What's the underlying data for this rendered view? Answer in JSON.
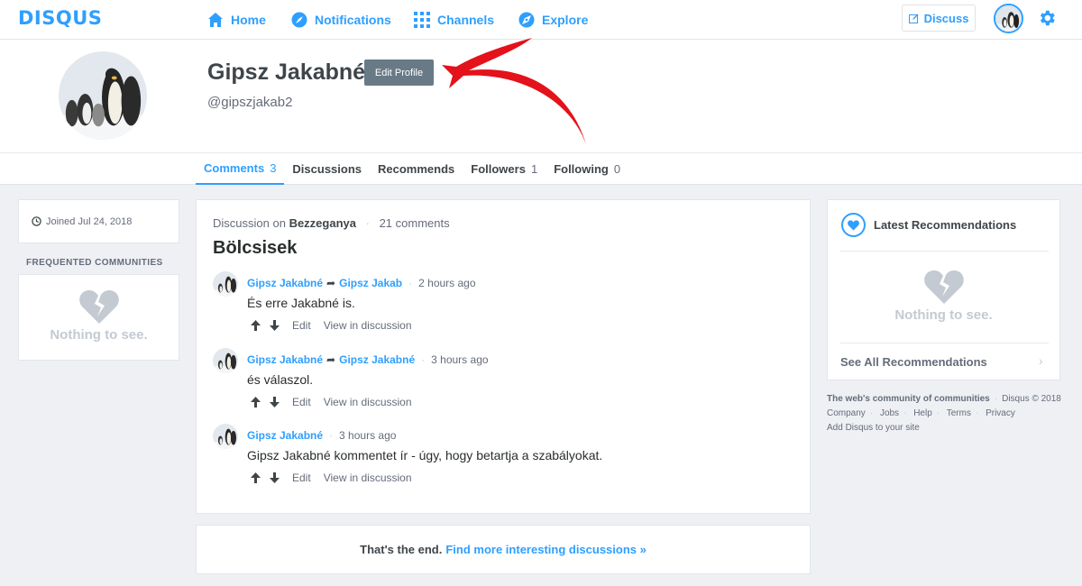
{
  "header": {
    "logo": "DISQUS",
    "nav": [
      {
        "label": "Home",
        "icon": "home-icon"
      },
      {
        "label": "Notifications",
        "icon": "compass-icon"
      },
      {
        "label": "Channels",
        "icon": "grid-icon"
      },
      {
        "label": "Explore",
        "icon": "explore-icon"
      }
    ],
    "discuss_label": "Discuss",
    "accent": "#2e9fff"
  },
  "profile": {
    "name": "Gipsz Jakabné",
    "edit_label": "Edit Profile",
    "handle": "@gipszjakab2",
    "tabs": [
      {
        "label": "Comments",
        "count": "3",
        "active": true
      },
      {
        "label": "Discussions",
        "count": ""
      },
      {
        "label": "Recommends",
        "count": ""
      },
      {
        "label": "Followers",
        "count": "1"
      },
      {
        "label": "Following",
        "count": "0"
      }
    ]
  },
  "sidebar": {
    "joined": "Joined Jul 24, 2018",
    "frequented_title": "FREQUENTED COMMUNITIES",
    "empty_text": "Nothing to see."
  },
  "discussion": {
    "prefix": "Discussion on",
    "community": "Bezzeganya",
    "comments_count": "21 comments",
    "title": "Bölcsisek",
    "comments": [
      {
        "author": "Gipsz Jakabné",
        "reply_to": "Gipsz Jakab",
        "time": "2 hours ago",
        "text": "És erre Jakabné is.",
        "edit": "Edit",
        "view": "View in discussion"
      },
      {
        "author": "Gipsz Jakabné",
        "reply_to": "Gipsz Jakabné",
        "time": "3 hours ago",
        "text": "és válaszol.",
        "edit": "Edit",
        "view": "View in discussion"
      },
      {
        "author": "Gipsz Jakabné",
        "reply_to": "",
        "time": "3 hours ago",
        "text": "Gipsz Jakabné kommentet ír - úgy, hogy betartja a szabályokat.",
        "edit": "Edit",
        "view": "View in discussion"
      }
    ],
    "end_text": "That's the end.",
    "end_link": "Find more interesting discussions »"
  },
  "recommendations": {
    "title": "Latest Recommendations",
    "empty_text": "Nothing to see.",
    "see_all": "See All Recommendations"
  },
  "footer": {
    "tagline": "The web's community of communities",
    "copyright": "Disqus © 2018",
    "links": [
      "Company",
      "Jobs",
      "Help",
      "Terms",
      "Privacy"
    ],
    "add": "Add Disqus to your site"
  }
}
